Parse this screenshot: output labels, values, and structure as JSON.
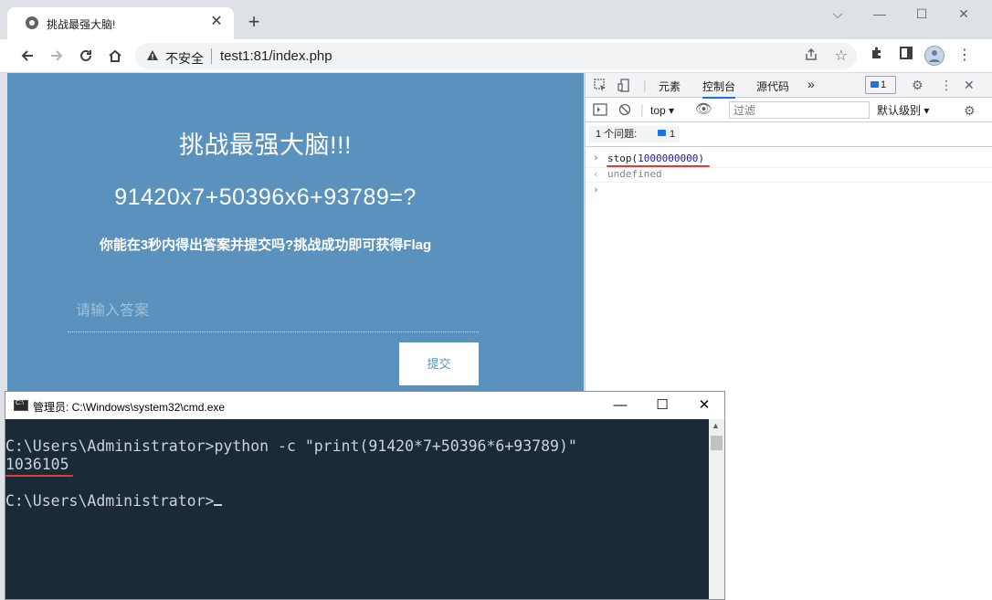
{
  "browser": {
    "tab_title": "挑战最强大脑!",
    "tab_close": "✕",
    "new_tab": "+",
    "security_label": "不安全",
    "url": "test1:81/index.php",
    "window_controls": [
      "⌵",
      "—",
      "☐",
      "✕"
    ]
  },
  "page": {
    "heading": "挑战最强大脑!!!",
    "equation": "91420x7+50396x6+93789=?",
    "hint": "你能在3秒内得出答案并提交吗?挑战成功即可获得Flag",
    "answer_placeholder": "请输入答案",
    "submit_label": "提交"
  },
  "devtools": {
    "tabs": [
      "元素",
      "控制台",
      "源代码"
    ],
    "more": "»",
    "issue_count": "1",
    "context": "top",
    "filter_placeholder": "过滤",
    "level": "默认级别",
    "issues_label": "1 个问题:",
    "issues_count": "1",
    "console": [
      {
        "type": "input",
        "text": "stop(",
        "arg": "1000000000",
        "close": ")"
      },
      {
        "type": "output",
        "text": "undefined"
      }
    ]
  },
  "cmd": {
    "title": "管理员: C:\\Windows\\system32\\cmd.exe",
    "lines": [
      "C:\\Users\\Administrator>python -c \"print(91420*7+50396*6+93789)\"",
      "1036105",
      "",
      "C:\\Users\\Administrator>"
    ]
  },
  "colors": {
    "page_bg": "#5b92bd",
    "cmd_bg": "#1b2a38",
    "annotation": "#e53935",
    "devtools_accent": "#1a73e8"
  }
}
